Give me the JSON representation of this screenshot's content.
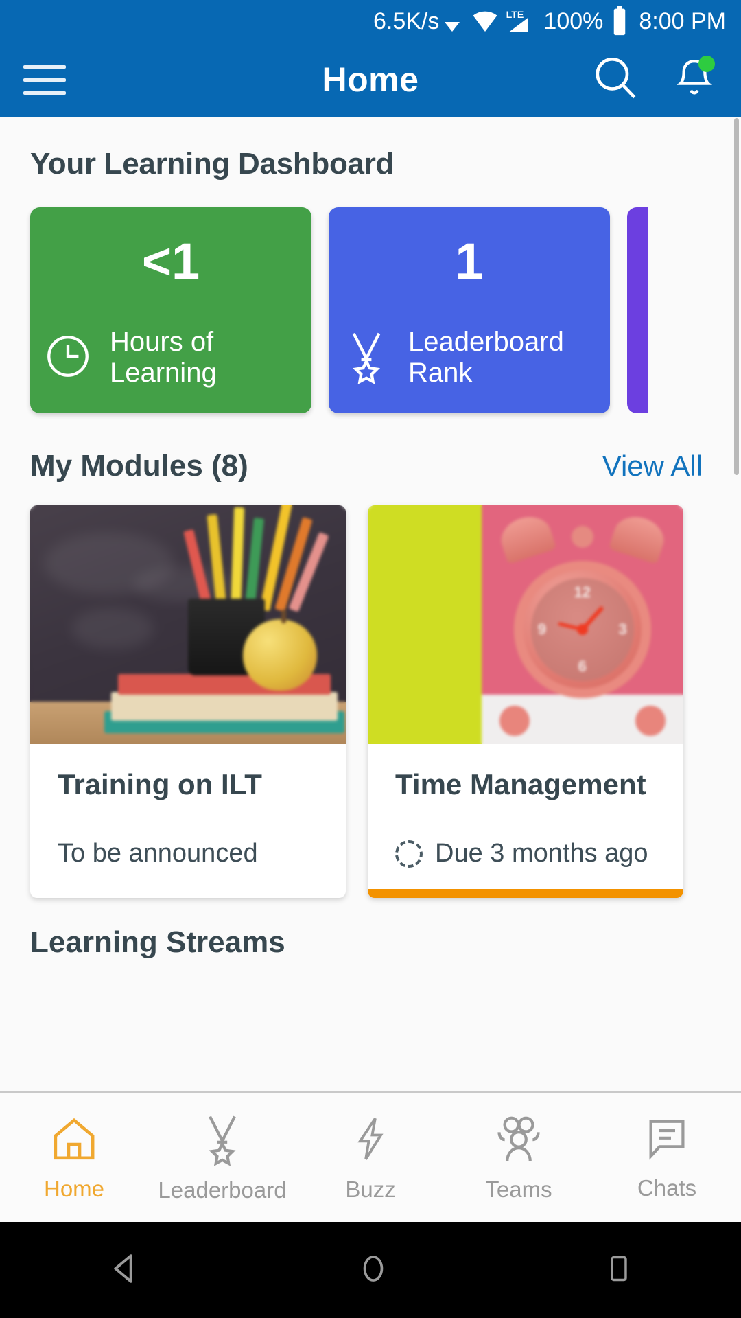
{
  "status_bar": {
    "network_speed": "6.5K/s",
    "dropdown_icon": "caret-down-icon",
    "wifi_icon": "wifi-icon",
    "signal_label": "LTE",
    "battery_percent": "100%",
    "battery_icon": "battery-full-icon",
    "time": "8:00 PM"
  },
  "app_bar": {
    "menu_icon": "hamburger-menu-icon",
    "title": "Home",
    "search_icon": "search-icon",
    "notification_icon": "bell-icon",
    "notification_badge_color": "#2ecc40",
    "background_color": "#0768b3"
  },
  "dashboard": {
    "heading": "Your Learning Dashboard",
    "cards": [
      {
        "value": "<1",
        "label": "Hours of Learning",
        "icon": "clock-icon",
        "color": "#43a047"
      },
      {
        "value": "1",
        "label": "Leaderboard Rank",
        "icon": "medal-icon",
        "color": "#4763e4"
      },
      {
        "value": "",
        "label": "",
        "icon": "",
        "color": "#6c3fe0"
      }
    ]
  },
  "modules_section": {
    "title": "My Modules (8)",
    "view_all_label": "View All",
    "view_all_color": "#1273bd",
    "cards": [
      {
        "name": "Training on ILT",
        "status": "To be announced",
        "status_icon": "",
        "progress_percent": 0,
        "thumbnail": "classroom-chalkboard-photo"
      },
      {
        "name": "Time Management",
        "status": "Due 3 months ago",
        "status_icon": "dashed-circle-icon",
        "progress_percent": 100,
        "progress_color": "#f39200",
        "thumbnail": "pink-alarm-clock-photo"
      }
    ]
  },
  "streams_section": {
    "title": "Learning Streams"
  },
  "bottom_nav": {
    "active_color": "#f0a830",
    "inactive_color": "#9a9a9a",
    "items": [
      {
        "label": "Home",
        "icon": "home-icon",
        "active": true
      },
      {
        "label": "Leaderboard",
        "icon": "medal-icon",
        "active": false
      },
      {
        "label": "Buzz",
        "icon": "lightning-bolt-icon",
        "active": false
      },
      {
        "label": "Teams",
        "icon": "people-icon",
        "active": false
      },
      {
        "label": "Chats",
        "icon": "chat-bubble-icon",
        "active": false
      }
    ]
  },
  "android_nav": {
    "back_icon": "triangle-back-icon",
    "home_icon": "circle-home-icon",
    "recents_icon": "square-recents-icon"
  }
}
